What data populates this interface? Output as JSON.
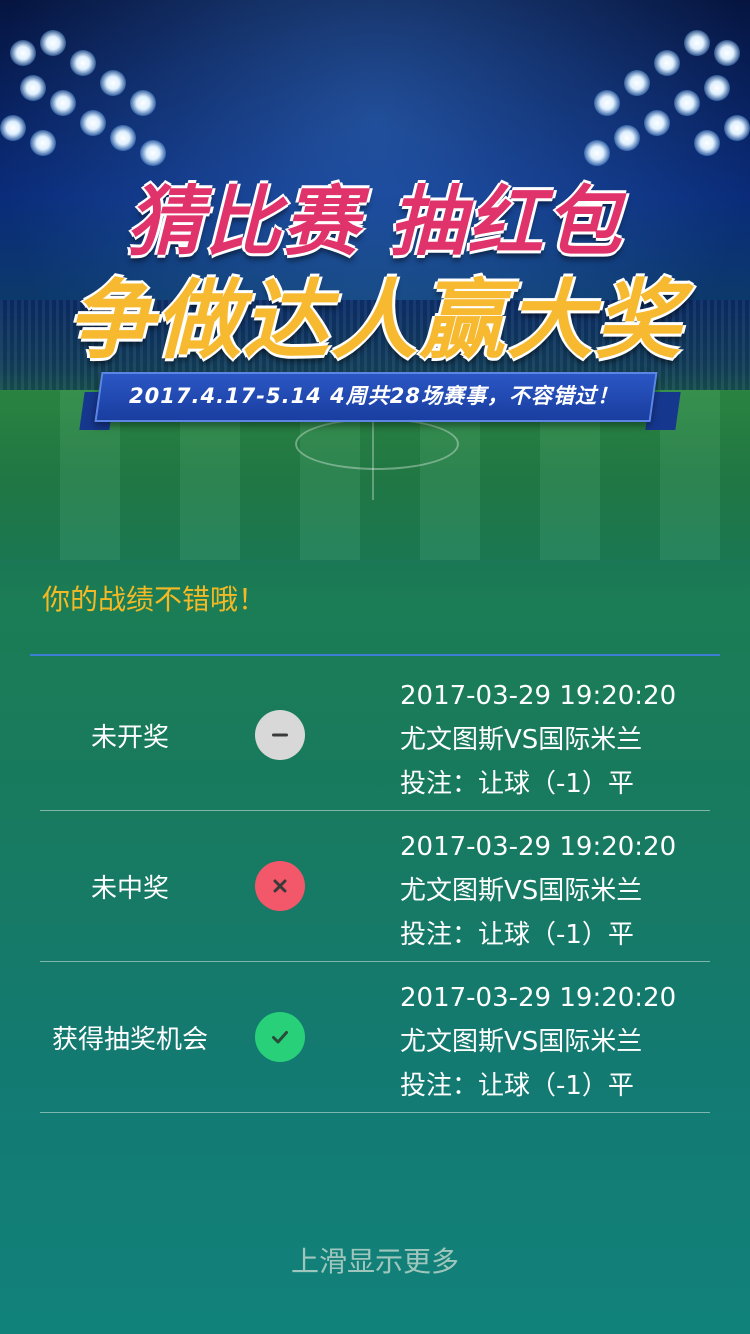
{
  "banner": {
    "title_line1": "猜比赛 抽红包",
    "title_line2": "争做达人赢大奖",
    "date_text": "2017.4.17-5.14  4周共28场赛事，不容错过！"
  },
  "record_title": "你的战绩不错哦！",
  "records": [
    {
      "status": "未开奖",
      "icon": "minus-icon",
      "datetime": "2017-03-29  19:20:20",
      "match": "尤文图斯VS国际米兰",
      "bet": "投注：让球（-1）平"
    },
    {
      "status": "未中奖",
      "icon": "close-icon",
      "datetime": "2017-03-29  19:20:20",
      "match": "尤文图斯VS国际米兰",
      "bet": "投注：让球（-1）平"
    },
    {
      "status": "获得抽奖机会",
      "icon": "check-icon",
      "datetime": "2017-03-29  19:20:20",
      "match": "尤文图斯VS国际米兰",
      "bet": "投注：让球（-1）平"
    }
  ],
  "footer_hint": "上滑显示更多",
  "colors": {
    "accent_gold": "#f5b925",
    "divider_blue": "#3d7fd6",
    "status_pending": "#d8d8d8",
    "status_lost": "#f2586a",
    "status_won": "#29d07a"
  }
}
